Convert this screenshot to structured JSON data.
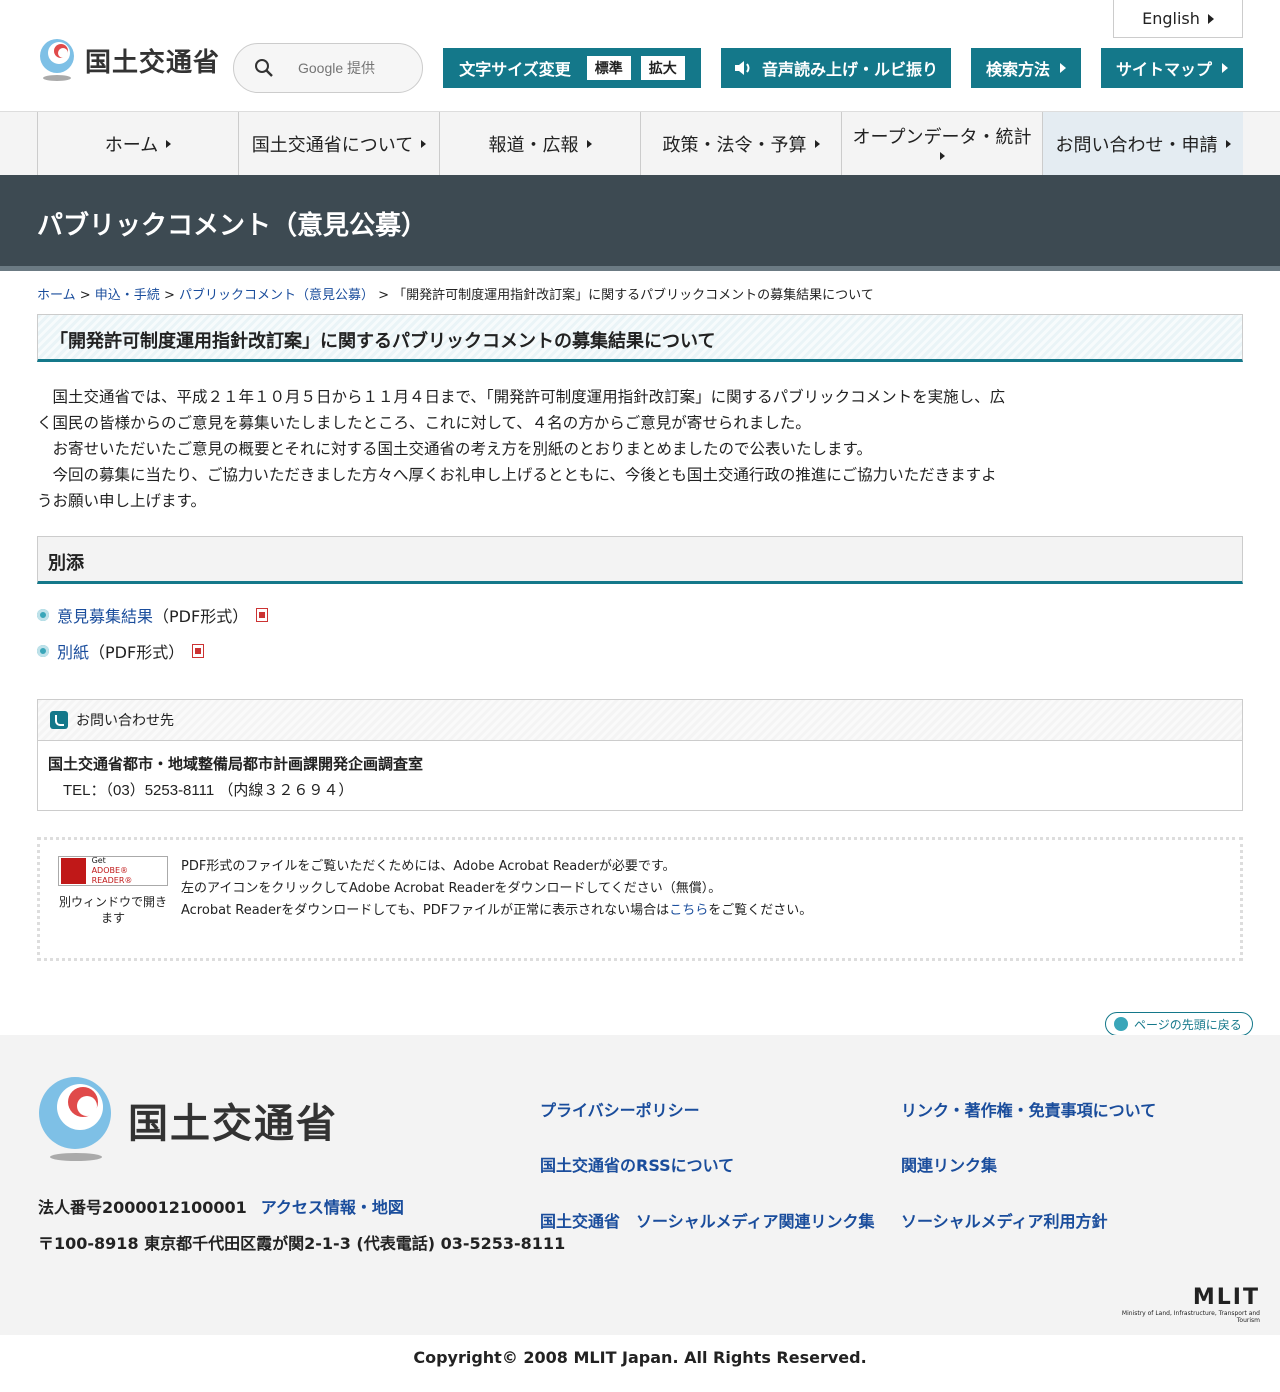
{
  "header": {
    "logo_text": "国土交通省",
    "search_placeholder": "Google 提供",
    "english": "English",
    "font_size_label": "文字サイズ変更",
    "font_standard": "標準",
    "font_large": "拡大",
    "voice_label": "音声読み上げ・ルビ振り",
    "search_method": "検索方法",
    "sitemap": "サイトマップ"
  },
  "nav": [
    {
      "label": "ホーム"
    },
    {
      "label": "国土交通省について"
    },
    {
      "label": "報道・広報"
    },
    {
      "label": "政策・法令・予算"
    },
    {
      "label": "オープンデータ・統計"
    },
    {
      "label": "お問い合わせ・申請"
    }
  ],
  "page_title": "パブリックコメント（意見公募）",
  "breadcrumb": {
    "home": "ホーム",
    "apply": "申込・手続",
    "pubcom": "パブリックコメント（意見公募）",
    "sep": " > ",
    "current": "「開発許可制度運用指針改訂案」に関するパブリックコメントの募集結果について"
  },
  "article": {
    "heading": "「開発許可制度運用指針改訂案」に関するパブリックコメントの募集結果について",
    "para1": "　国土交通省では、平成２１年１０月５日から１１月４日まで、「開発許可制度運用指針改訂案」に関するパブリックコメントを実施し、広く国民の皆様からのご意見を募集いたしましたところ、これに対して、４名の方からご意見が寄せられました。",
    "para2": "　お寄せいただいたご意見の概要とそれに対する国土交通省の考え方を別紙のとおりまとめましたので公表いたします。",
    "para3": "　今回の募集に当たり、ご協力いただきました方々へ厚くお礼申し上げるとともに、今後とも国土交通行政の推進にご協力いただきますようお願い申し上げます。"
  },
  "attachments": {
    "heading": "別添",
    "items": [
      {
        "link": "意見募集結果",
        "format": "（PDF形式）"
      },
      {
        "link": "別紙",
        "format": "（PDF形式）"
      }
    ]
  },
  "contact": {
    "heading": "お問い合わせ先",
    "dept": "国土交通省都市・地域整備局都市計画課開発企画調査室",
    "tel": "　TEL：（03）5253-8111 （内線３２６９４）"
  },
  "acrobat": {
    "badge_line1": "Get",
    "badge_line2": "ADOBE® READER®",
    "caption": "別ウィンドウで開きます",
    "line1": "PDF形式のファイルをご覧いただくためには、Adobe Acrobat Readerが必要です。",
    "line2": "左のアイコンをクリックしてAdobe Acrobat Readerをダウンロードしてください（無償）。",
    "line3_pre": "Acrobat Readerをダウンロードしても、PDFファイルが正常に表示されない場合は",
    "line3_link": "こちら",
    "line3_post": "をご覧ください。"
  },
  "pagetop": "ページの先頭に戻る",
  "footer": {
    "logo_text": "国土交通省",
    "corp_number": "法人番号2000012100001",
    "access": "アクセス情報・地図",
    "address": "〒100-8918 東京都千代田区霞が関2-1-3 (代表電話) 03-5253-8111",
    "links": [
      "プライバシーポリシー",
      "リンク・著作権・免責事項について",
      "国土交通省のRSSについて",
      "関連リンク集",
      "国土交通省　ソーシャルメディア関連リンク集",
      "ソーシャルメディア利用方針"
    ],
    "mlit": "MLIT",
    "mlit_sub": "Ministry of Land, Infrastructure, Transport and Tourism",
    "copyright": "Copyright© 2008 MLIT Japan. All Rights Reserved."
  },
  "colors": {
    "accent": "#14788a",
    "title_band": "#3d4a52",
    "link": "#1a4d9c"
  }
}
